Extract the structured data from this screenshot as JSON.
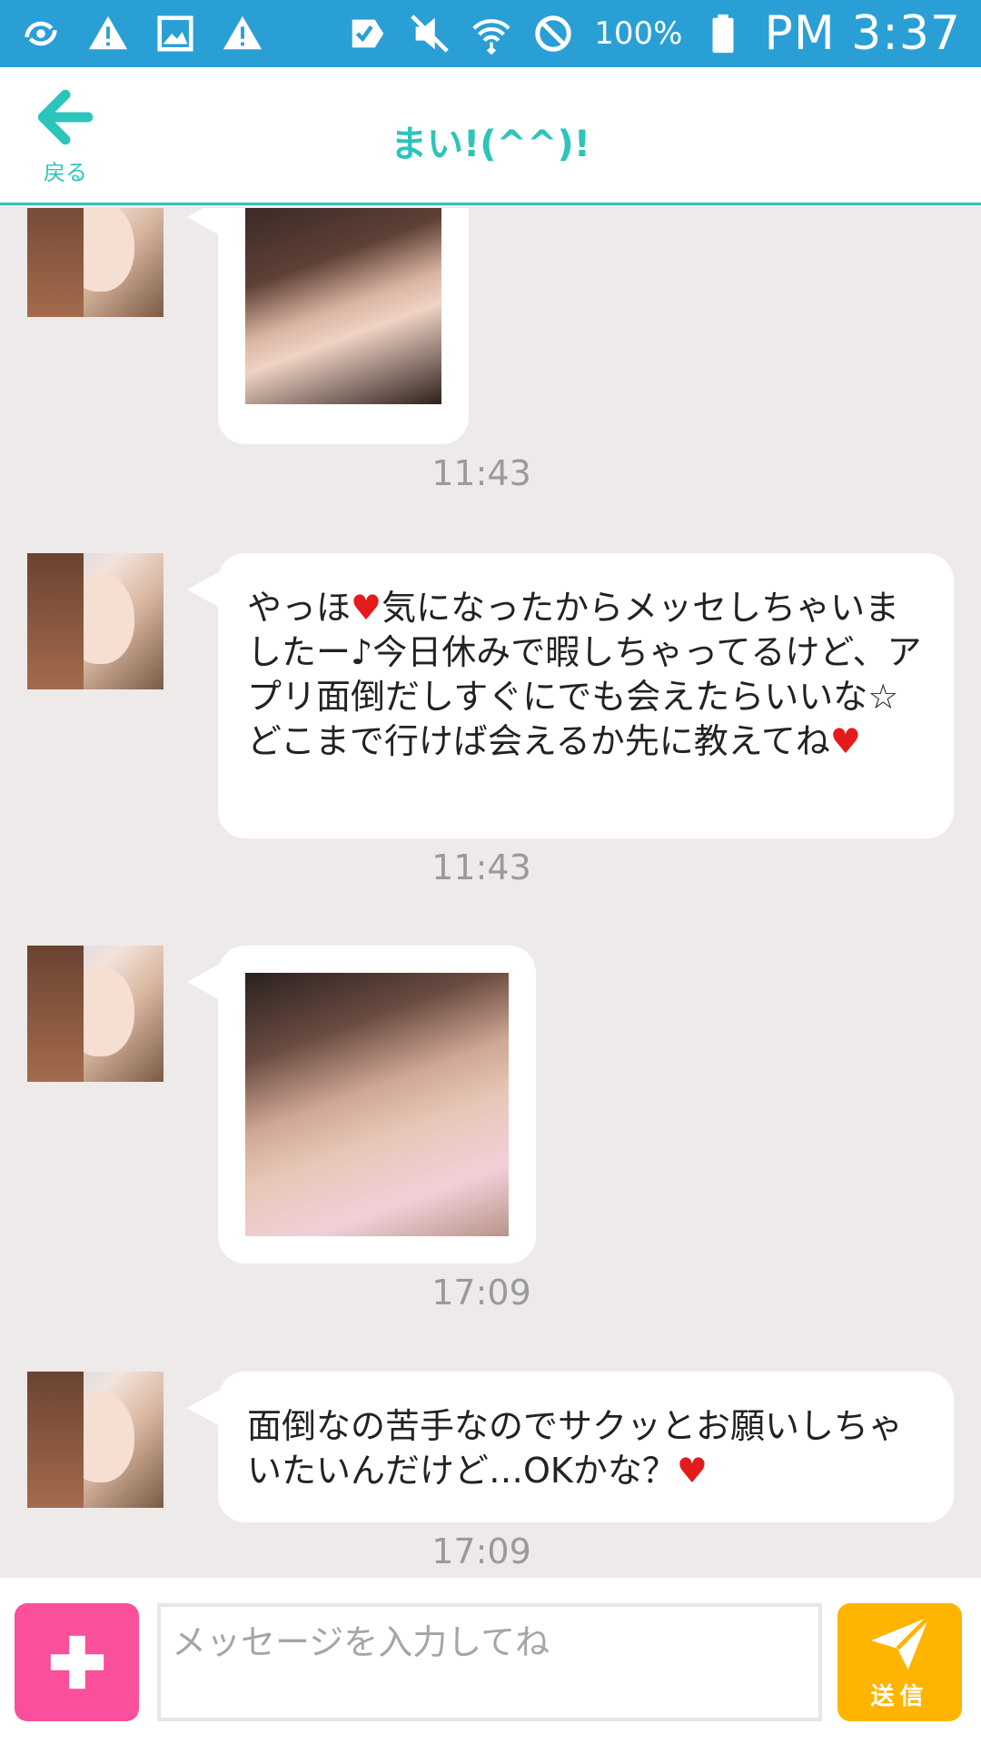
{
  "status_bar": {
    "battery_percent": "100%",
    "time": "PM 3:37",
    "left_icons": [
      "sync-icon",
      "warning-icon",
      "image-icon",
      "warning-icon"
    ],
    "right_icons": [
      "checkbox-icon",
      "mute-icon",
      "wifi-icon",
      "do-not-disturb-icon",
      "battery-icon"
    ]
  },
  "header": {
    "back_label": "戻る",
    "title": "まい!(^^)!"
  },
  "messages": [
    {
      "type": "image",
      "time": "11:43"
    },
    {
      "type": "text",
      "text": "やっほ♥気になったからメッセしちゃいましたー♪今日休みで暇しちゃってるけど、アプリ面倒だしすぐにでも会えたらいいな☆どこまで行けば会えるか先に教えてね♥",
      "time": "11:43"
    },
    {
      "type": "image",
      "time": "17:09"
    },
    {
      "type": "text",
      "text": "面倒なの苦手なのでサクッとお願いしちゃいたいんだけど…OKかな？♥",
      "time": "17:09"
    }
  ],
  "input_bar": {
    "placeholder": "メッセージを入力してね",
    "send_label": "送信"
  },
  "colors": {
    "status_bar": "#2a9fd6",
    "accent": "#2cc4bb",
    "plus_button": "#fa4f9a",
    "send_button": "#ffb400",
    "heart": "#e41b1b"
  }
}
